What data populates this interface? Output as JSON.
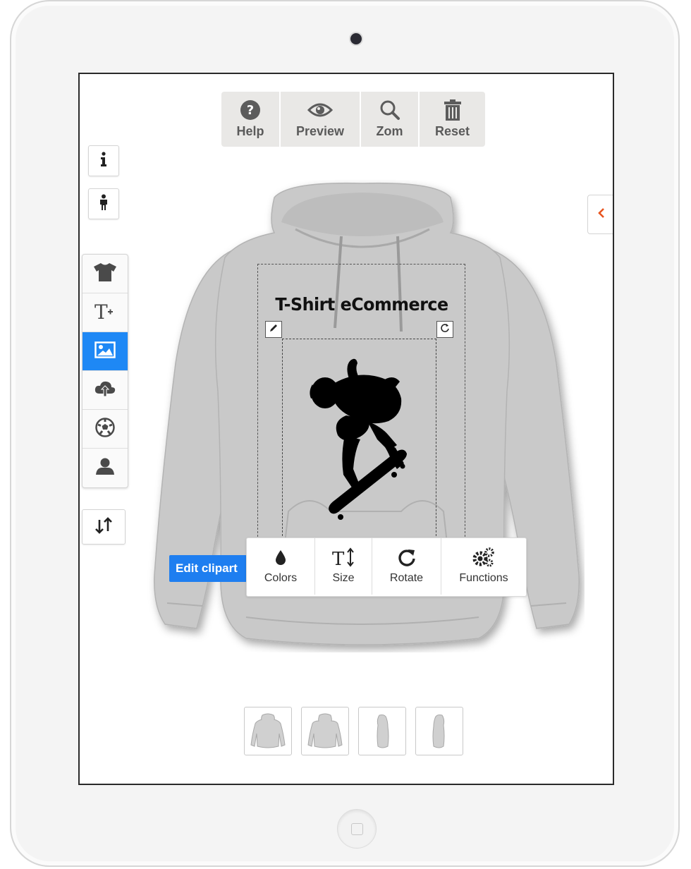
{
  "toolbar": {
    "items": [
      {
        "label": "Help",
        "icon": "question-circle-icon"
      },
      {
        "label": "Preview",
        "icon": "eye-icon"
      },
      {
        "label": "Zom",
        "icon": "search-icon"
      },
      {
        "label": "Reset",
        "icon": "trash-icon"
      }
    ]
  },
  "left_tools": {
    "info_icon": "info-icon",
    "person_icon": "person-icon",
    "nav": [
      {
        "icon": "tshirt-icon",
        "active": false
      },
      {
        "icon": "add-text-icon",
        "active": false
      },
      {
        "icon": "image-icon",
        "active": true
      },
      {
        "icon": "cloud-upload-icon",
        "active": false
      },
      {
        "icon": "soccer-ball-icon",
        "active": false
      },
      {
        "icon": "user-icon",
        "active": false
      }
    ],
    "sort_icon": "sort-arrows-icon"
  },
  "design": {
    "title_text": "T-Shirt eCommerce"
  },
  "edit_clipart": {
    "badge": "Edit clipart",
    "actions": [
      {
        "label": "Colors",
        "icon": "droplet-icon"
      },
      {
        "label": "Size",
        "icon": "text-size-icon"
      },
      {
        "label": "Rotate",
        "icon": "rotate-icon"
      },
      {
        "label": "Functions",
        "icon": "gears-icon"
      }
    ]
  },
  "views": [
    "front",
    "back",
    "left",
    "right"
  ],
  "colors": {
    "accent": "#1e88f5",
    "toolbar_bg": "#e9e8e6",
    "hoodie": "#c9c9c9",
    "collapse_arrow": "#e8541e"
  }
}
